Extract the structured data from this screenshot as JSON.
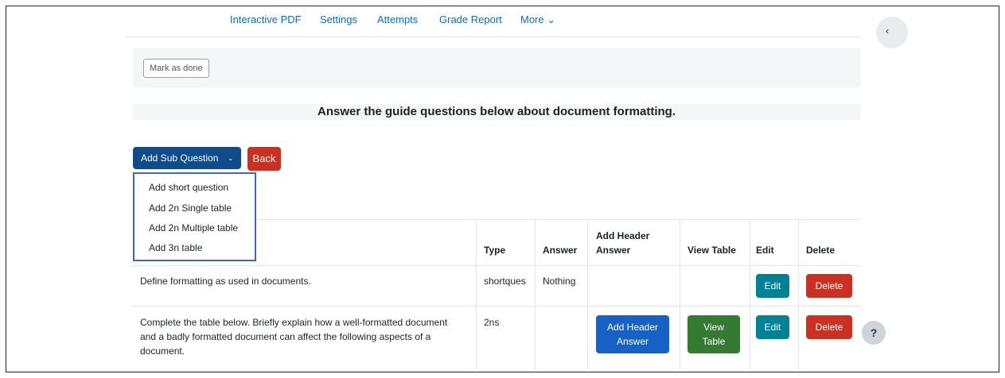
{
  "nav": {
    "items": [
      "Interactive PDF",
      "Settings",
      "Attempts",
      "Grade Report",
      "More ⌄"
    ]
  },
  "drawer": {
    "icon": "chevron-left-icon",
    "glyph": "‹"
  },
  "activity": {
    "mark_done_label": "Mark as done"
  },
  "heading": "Answer the guide questions below about document formatting.",
  "actions": {
    "add_sub_question_label": "Add Sub Question",
    "chevron": "⌄",
    "back_label": "Back"
  },
  "dropdown": {
    "items": [
      "Add short question",
      "Add 2n Single table",
      "Add 2n Multiple table",
      "Add 3n table"
    ]
  },
  "table": {
    "headers": {
      "type": "Type",
      "answer": "Answer",
      "add_header_answer_line1": "Add Header",
      "add_header_answer_line2": "Answer",
      "view_table": "View Table",
      "edit": "Edit",
      "delete": "Delete"
    },
    "rows": [
      {
        "question": "Define formatting as used in documents.",
        "type": "shortques",
        "answer": "Nothing",
        "edit_label": "Edit",
        "delete_label": "Delete"
      },
      {
        "question_line1": "Complete the table below. Briefly explain how a well-formatted document",
        "question_line2": "and a badly formatted document can affect the following aspects of a",
        "question_line3": "document.",
        "type": "2ns",
        "answer": "",
        "add_header_line1": "Add Header",
        "add_header_line2": "Answer",
        "view_table_line1": "View",
        "view_table_line2": "Table",
        "edit_label": "Edit",
        "delete_label": "Delete"
      }
    ]
  },
  "help": {
    "glyph": "?"
  },
  "colors": {
    "link": "#0f6cbf",
    "primary": "#0f4c8c",
    "danger": "#ca3120",
    "info": "#008196",
    "blue": "#1561c6",
    "success": "#357a32",
    "dropdown_border": "#3f66c8"
  }
}
